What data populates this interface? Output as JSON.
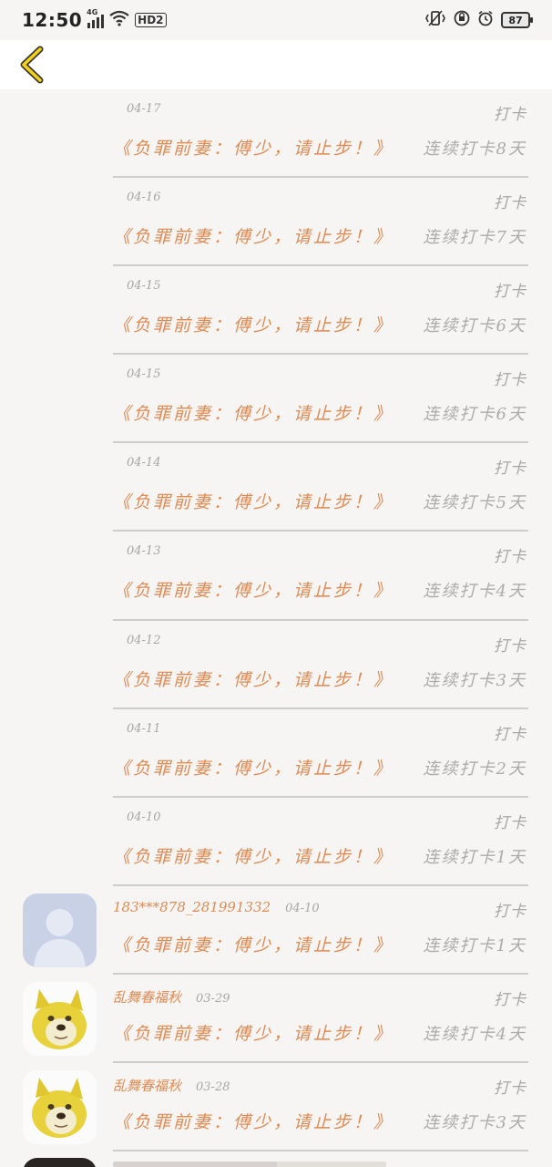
{
  "status_bar": {
    "time": "12:50",
    "network": "4G",
    "hd": "HD2",
    "battery": "87",
    "icons": [
      "signal-icon",
      "wifi-icon",
      "hd-icon",
      "vibrate-icon",
      "do-not-disturb-icon",
      "alarm-icon",
      "battery-icon"
    ]
  },
  "nav": {
    "back_icon": "chevron-left-icon",
    "accent_color": "#f2d21b"
  },
  "colors": {
    "title_orange": "#e08a52",
    "muted_gray": "#a6a6a6",
    "background": "#f6f5f4"
  },
  "rows": [
    {
      "name": "",
      "date": "04-17",
      "action": "打卡",
      "title": "《负罪前妻：傅少，请止步！》",
      "streak": "连续打卡8天",
      "avatar": "none"
    },
    {
      "name": "",
      "date": "04-16",
      "action": "打卡",
      "title": "《负罪前妻：傅少，请止步！》",
      "streak": "连续打卡7天",
      "avatar": "none"
    },
    {
      "name": "",
      "date": "04-15",
      "action": "打卡",
      "title": "《负罪前妻：傅少，请止步！》",
      "streak": "连续打卡6天",
      "avatar": "none"
    },
    {
      "name": "",
      "date": "04-15",
      "action": "打卡",
      "title": "《负罪前妻：傅少，请止步！》",
      "streak": "连续打卡6天",
      "avatar": "none"
    },
    {
      "name": "",
      "date": "04-14",
      "action": "打卡",
      "title": "《负罪前妻：傅少，请止步！》",
      "streak": "连续打卡5天",
      "avatar": "none"
    },
    {
      "name": "",
      "date": "04-13",
      "action": "打卡",
      "title": "《负罪前妻：傅少，请止步！》",
      "streak": "连续打卡4天",
      "avatar": "none"
    },
    {
      "name": "",
      "date": "04-12",
      "action": "打卡",
      "title": "《负罪前妻：傅少，请止步！》",
      "streak": "连续打卡3天",
      "avatar": "none"
    },
    {
      "name": "",
      "date": "04-11",
      "action": "打卡",
      "title": "《负罪前妻：傅少，请止步！》",
      "streak": "连续打卡2天",
      "avatar": "none"
    },
    {
      "name": "",
      "date": "04-10",
      "action": "打卡",
      "title": "《负罪前妻：傅少，请止步！》",
      "streak": "连续打卡1天",
      "avatar": "none"
    },
    {
      "name": "183***878_281991332",
      "date": "04-10",
      "action": "打卡",
      "title": "《负罪前妻：傅少，请止步！》",
      "streak": "连续打卡1天",
      "avatar": "default-user-avatar"
    },
    {
      "name": "乱舞春福秋",
      "date": "03-29",
      "action": "打卡",
      "title": "《负罪前妻：傅少，请止步！》",
      "streak": "连续打卡4天",
      "avatar": "doge-avatar"
    },
    {
      "name": "乱舞春福秋",
      "date": "03-28",
      "action": "打卡",
      "title": "《负罪前妻：傅少，请止步！》",
      "streak": "连续打卡3天",
      "avatar": "doge-avatar"
    }
  ]
}
